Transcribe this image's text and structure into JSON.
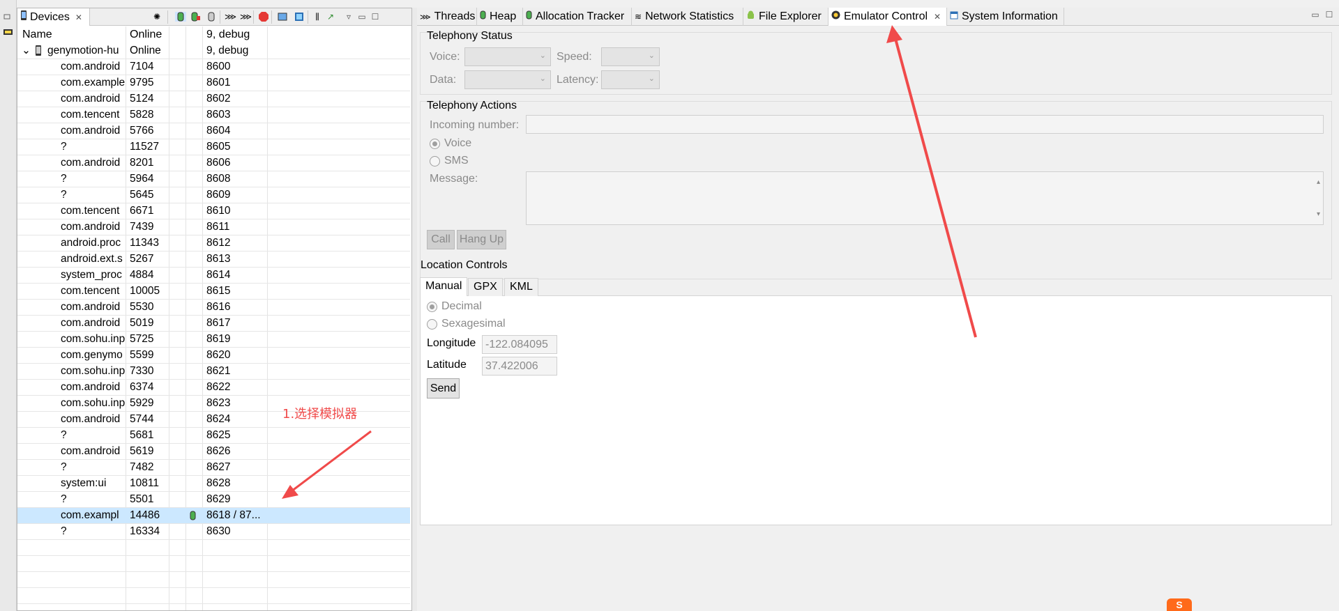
{
  "devices_view": {
    "tab_title": "Devices",
    "columns": [
      "Name",
      "Online",
      "9, debug"
    ],
    "device": {
      "name": "genymotion-hu"
    },
    "processes": [
      {
        "name": "com.android",
        "pid": "7104",
        "port": "8600"
      },
      {
        "name": "com.example",
        "pid": "9795",
        "port": "8601"
      },
      {
        "name": "com.android",
        "pid": "5124",
        "port": "8602"
      },
      {
        "name": "com.tencent",
        "pid": "5828",
        "port": "8603"
      },
      {
        "name": "com.android",
        "pid": "5766",
        "port": "8604"
      },
      {
        "name": "?",
        "pid": "11527",
        "port": "8605"
      },
      {
        "name": "com.android",
        "pid": "8201",
        "port": "8606"
      },
      {
        "name": "?",
        "pid": "5964",
        "port": "8608"
      },
      {
        "name": "?",
        "pid": "5645",
        "port": "8609"
      },
      {
        "name": "com.tencent",
        "pid": "6671",
        "port": "8610"
      },
      {
        "name": "com.android",
        "pid": "7439",
        "port": "8611"
      },
      {
        "name": "android.proc",
        "pid": "11343",
        "port": "8612"
      },
      {
        "name": "android.ext.s",
        "pid": "5267",
        "port": "8613"
      },
      {
        "name": "system_proc",
        "pid": "4884",
        "port": "8614"
      },
      {
        "name": "com.tencent",
        "pid": "10005",
        "port": "8615"
      },
      {
        "name": "com.android",
        "pid": "5530",
        "port": "8616"
      },
      {
        "name": "com.android",
        "pid": "5019",
        "port": "8617"
      },
      {
        "name": "com.sohu.inp",
        "pid": "5725",
        "port": "8619"
      },
      {
        "name": "com.genymo",
        "pid": "5599",
        "port": "8620"
      },
      {
        "name": "com.sohu.inp",
        "pid": "7330",
        "port": "8621"
      },
      {
        "name": "com.android",
        "pid": "6374",
        "port": "8622"
      },
      {
        "name": "com.sohu.inp",
        "pid": "5929",
        "port": "8623"
      },
      {
        "name": "com.android",
        "pid": "5744",
        "port": "8624"
      },
      {
        "name": "?",
        "pid": "5681",
        "port": "8625"
      },
      {
        "name": "com.android",
        "pid": "5619",
        "port": "8626"
      },
      {
        "name": "?",
        "pid": "7482",
        "port": "8627"
      },
      {
        "name": "system:ui",
        "pid": "10811",
        "port": "8628"
      },
      {
        "name": "?",
        "pid": "5501",
        "port": "8629"
      },
      {
        "name": "com.exampl",
        "pid": "14486",
        "port": "8618 / 87...",
        "selected": true
      },
      {
        "name": "?",
        "pid": "16334",
        "port": "8630"
      }
    ]
  },
  "tabs": [
    "Threads",
    "Heap",
    "Allocation Tracker",
    "Network Statistics",
    "File Explorer",
    "Emulator Control",
    "System Information"
  ],
  "telephony_status": {
    "title": "Telephony Status",
    "voice_label": "Voice:",
    "speed_label": "Speed:",
    "data_label": "Data:",
    "latency_label": "Latency:"
  },
  "telephony_actions": {
    "title": "Telephony Actions",
    "incoming_label": "Incoming number:",
    "voice_option": "Voice",
    "sms_option": "SMS",
    "message_label": "Message:",
    "call_button": "Call",
    "hangup_button": "Hang Up"
  },
  "location_controls": {
    "title": "Location Controls",
    "tabs": [
      "Manual",
      "GPX",
      "KML"
    ],
    "decimal_option": "Decimal",
    "sexagesimal_option": "Sexagesimal",
    "longitude_label": "Longitude",
    "longitude_value": "-122.084095",
    "latitude_label": "Latitude",
    "latitude_value": "37.422006",
    "send_button": "Send"
  },
  "annotation": {
    "text": "1.选择模拟器",
    "color": "#f04a4a"
  },
  "taskbar": {
    "ime_label": "S"
  }
}
